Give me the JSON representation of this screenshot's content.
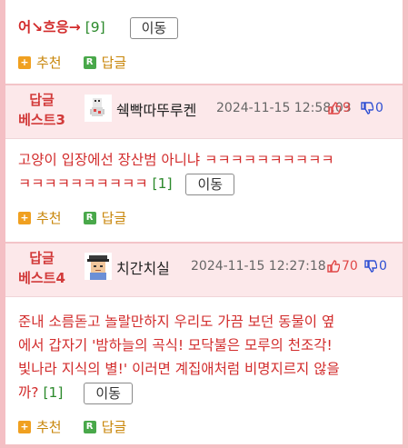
{
  "comments": [
    {
      "content": "어↘흐응→",
      "count": "[9]",
      "move_label": "이동",
      "recommend_label": "추천",
      "reply_label": "답글"
    },
    {
      "best_label_1": "답글",
      "best_label_2": "베스트3",
      "nickname": "쉑빡따뚜루켄",
      "timestamp": "2024-11-15 12:58:03",
      "up_count": "9",
      "down_count": "0",
      "content_line1": "고양이 입장에선 장산범 아니냐 ㅋㅋㅋㅋㅋㅋㅋㅋㅋㅋ",
      "content_line2": "ㅋㅋㅋㅋㅋㅋㅋㅋㅋㅋ",
      "count": "[1]",
      "move_label": "이동",
      "recommend_label": "추천",
      "reply_label": "답글"
    },
    {
      "best_label_1": "답글",
      "best_label_2": "베스트4",
      "nickname": "치간치실",
      "timestamp": "2024-11-15 12:27:18",
      "up_count": "70",
      "down_count": "0",
      "content_line1": "준내 소름돋고 놀랄만하지 우리도 가끔 보던 동물이 옆",
      "content_line2": "에서 갑자기 '밤하늘의 곡식! 모닥불은 모루의 천조각!",
      "content_line3": "빛나라 지식의 별!' 이러면 계집애처럼 비명지르지 않을",
      "content_line4": "까?",
      "count": "[1]",
      "move_label": "이동",
      "recommend_label": "추천",
      "reply_label": "답글"
    }
  ],
  "colors": {
    "accent_red": "#d22b2b",
    "border_pink": "#f4bfc4",
    "header_bg": "#fce8ea",
    "up_red": "#e04747",
    "down_blue": "#2e4fd3",
    "count_green": "#2c8a2c"
  }
}
